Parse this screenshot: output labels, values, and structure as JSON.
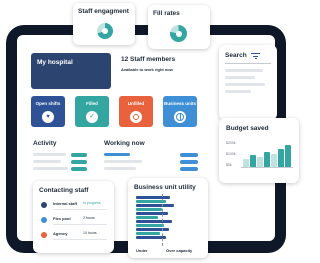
{
  "cards": {
    "staff_engagement": {
      "title": "Staff engagment"
    },
    "fill_rates": {
      "title": "Fill rates"
    },
    "search": {
      "title": "Search"
    },
    "budget": {
      "title": "Budget saved",
      "y_ticks": [
        "$200k",
        "$100k",
        "$0k"
      ]
    }
  },
  "hospital": {
    "title": "My hospital"
  },
  "staff": {
    "headline": "12 Staff members",
    "subline": "Available to work right now"
  },
  "tiles": [
    {
      "label": "Open shifts",
      "color": "#2f5296",
      "icon": "heart-icon"
    },
    {
      "label": "Filled",
      "color": "#34a6a1",
      "icon": "check-icon"
    },
    {
      "label": "Unfilled",
      "color": "#e8623e",
      "icon": "target-icon"
    },
    {
      "label": "Business units",
      "color": "#3e8fd6",
      "icon": "globe-icon"
    }
  ],
  "activity": {
    "title": "Activity"
  },
  "working": {
    "title": "Working now"
  },
  "contacting": {
    "title": "Contacting staff",
    "rows": [
      {
        "name": "Internal staff",
        "status": "In progress"
      },
      {
        "name": "Flex pool",
        "status": "2 hours"
      },
      {
        "name": "Agency",
        "status": "10 hours"
      }
    ]
  },
  "utility": {
    "title": "Business unit utility",
    "legend_under": "Under",
    "legend_over": "Over capacity"
  },
  "colors": {
    "teal": "#34a6a1",
    "navy": "#0f1828",
    "blue": "#2f5296",
    "orange": "#e8623e"
  }
}
